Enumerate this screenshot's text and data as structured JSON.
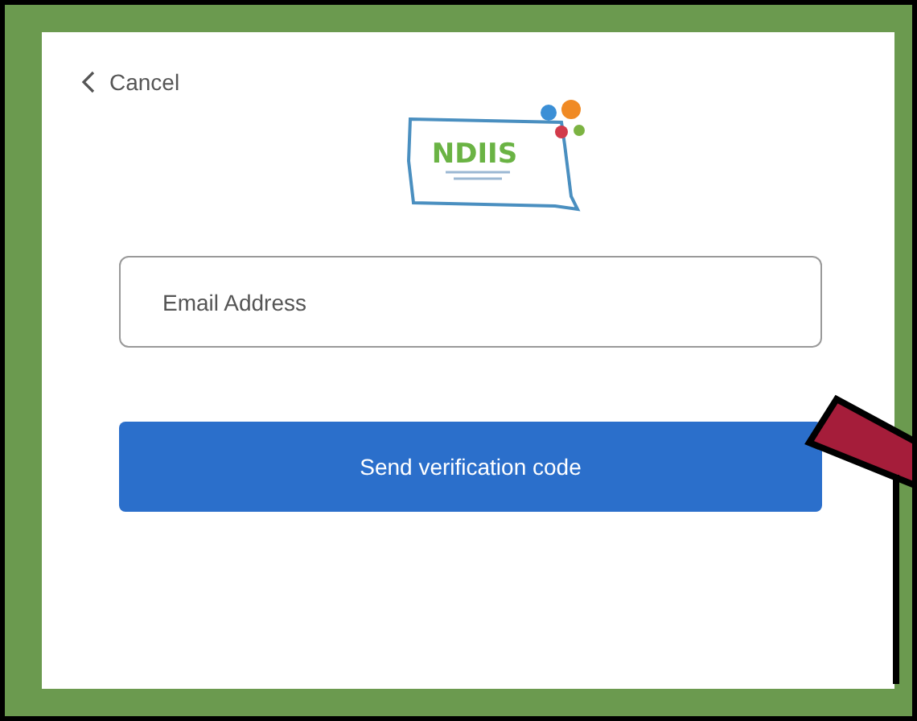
{
  "cancel_link": {
    "label": "Cancel"
  },
  "logo": {
    "name": "NDIIS"
  },
  "email_field": {
    "placeholder": "Email Address"
  },
  "send_button": {
    "label": "Send verification code"
  }
}
